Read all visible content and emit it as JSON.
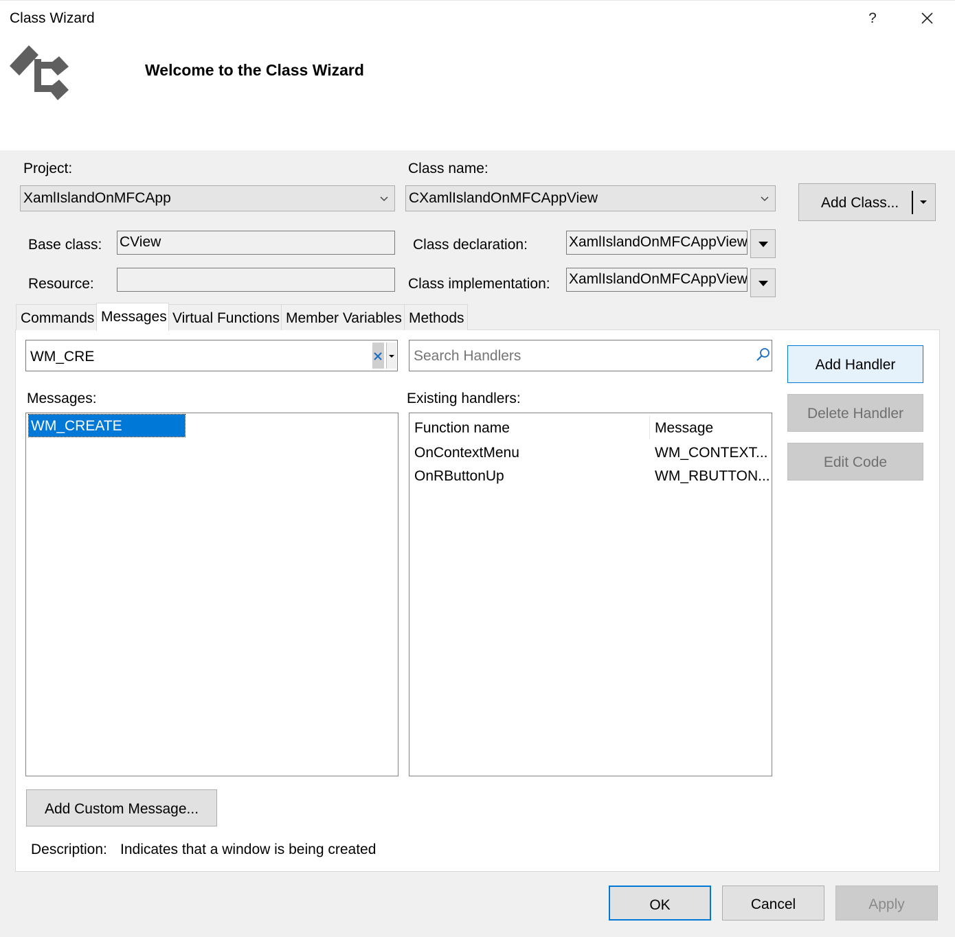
{
  "window": {
    "title": "Class Wizard",
    "help_label": "?",
    "header": "Welcome to the Class Wizard"
  },
  "project": {
    "label": "Project:",
    "value": "XamlIslandOnMFCApp"
  },
  "class_name": {
    "label": "Class name:",
    "value": "CXamlIslandOnMFCAppView"
  },
  "add_class": {
    "label": "Add Class..."
  },
  "base_class": {
    "label": "Base class:",
    "value": "CView"
  },
  "resource": {
    "label": "Resource:",
    "value": ""
  },
  "class_declaration": {
    "label": "Class declaration:",
    "value": "XamlIslandOnMFCAppView."
  },
  "class_implementation": {
    "label": "Class implementation:",
    "value": "XamlIslandOnMFCAppView."
  },
  "tabs": [
    {
      "label": "Commands"
    },
    {
      "label": "Messages"
    },
    {
      "label": "Virtual Functions"
    },
    {
      "label": "Member Variables"
    },
    {
      "label": "Methods"
    }
  ],
  "messages_tab": {
    "filter_value": "WM_CRE",
    "search_placeholder": "Search Handlers",
    "messages_label": "Messages:",
    "messages": [
      "WM_CREATE"
    ],
    "existing_label": "Existing handlers:",
    "columns": [
      "Function name",
      "Message"
    ],
    "handlers": [
      {
        "function": "OnContextMenu",
        "message": "WM_CONTEXT..."
      },
      {
        "function": "OnRButtonUp",
        "message": "WM_RBUTTON..."
      }
    ],
    "add_handler": "Add Handler",
    "delete_handler": "Delete Handler",
    "edit_code": "Edit Code",
    "add_custom_message": "Add Custom Message...",
    "description_label": "Description:",
    "description_value": "Indicates that a window is being created"
  },
  "footer": {
    "ok": "OK",
    "cancel": "Cancel",
    "apply": "Apply"
  },
  "colors": {
    "selection": "#0078d7",
    "focus_border": "#0078d7",
    "hover_button": "#e5f1fb"
  }
}
